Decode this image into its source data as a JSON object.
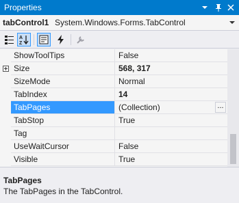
{
  "window": {
    "title": "Properties",
    "dropdown_icon": "chevron-down-icon",
    "pin_icon": "pin-icon",
    "close_icon": "close-icon"
  },
  "object_selector": {
    "name": "tabControl1",
    "type": "System.Windows.Forms.TabControl"
  },
  "toolbar": {
    "buttons": [
      "categorized-icon",
      "alphabetical-icon",
      "properties-icon",
      "events-icon"
    ]
  },
  "properties": [
    {
      "name": "ShowToolTips",
      "value": "False"
    },
    {
      "name": "Size",
      "value": "568, 317",
      "bold": true,
      "expandable": true
    },
    {
      "name": "SizeMode",
      "value": "Normal"
    },
    {
      "name": "TabIndex",
      "value": "14",
      "bold": true
    },
    {
      "name": "TabPages",
      "value": "(Collection)",
      "selected": true,
      "has_ellipsis": true
    },
    {
      "name": "TabStop",
      "value": "True"
    },
    {
      "name": "Tag",
      "value": ""
    },
    {
      "name": "UseWaitCursor",
      "value": "False"
    },
    {
      "name": "Visible",
      "value": "True"
    }
  ],
  "ellipsis_label": "...",
  "description": {
    "title": "TabPages",
    "text": "The TabPages in the TabControl."
  },
  "colors": {
    "title_bar": "#007acc",
    "selection": "#3399ff"
  }
}
